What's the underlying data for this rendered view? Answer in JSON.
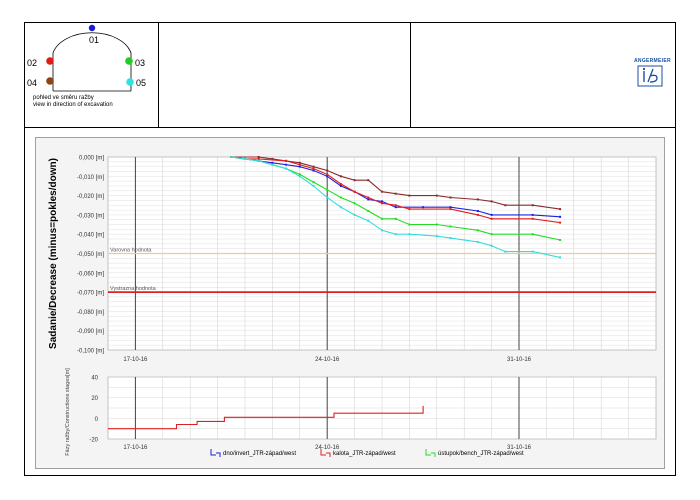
{
  "header": {
    "points": [
      {
        "id": "01",
        "color": "#1b1bd6"
      },
      {
        "id": "02",
        "color": "#e01b1b"
      },
      {
        "id": "03",
        "color": "#22cc22"
      },
      {
        "id": "04",
        "color": "#8b4513"
      },
      {
        "id": "05",
        "color": "#33e0e0"
      }
    ],
    "caption_line1": "pohled ve směru ražby",
    "caption_line2": "view in direction of excavation",
    "logo_text": "ANGERMEIER"
  },
  "chart_data": [
    {
      "type": "line",
      "ylabel": "Sadanie/Decrease (minus=pokles/down)",
      "xlim": [
        "2016-10-16",
        "2016-11-05"
      ],
      "ylim": [
        -0.1,
        0.0
      ],
      "y_ticks": [
        "0,000 [m]",
        "-0,010 [m]",
        "-0,020 [m]",
        "-0,030 [m]",
        "-0,040 [m]",
        "-0,050 [m]",
        "-0,060 [m]",
        "-0,070 [m]",
        "-0,080 [m]",
        "-0,090 [m]",
        "-0,100 [m]"
      ],
      "x_ticks": [
        {
          "label": "17-10-16",
          "x": "2016-10-17"
        },
        {
          "label": "24-10-16",
          "x": "2016-10-24"
        },
        {
          "label": "31-10-16",
          "x": "2016-10-31"
        }
      ],
      "thresholds": [
        {
          "label": "Varovna hodnota",
          "value": -0.05,
          "color": "#f0c890"
        },
        {
          "label": "Vystrazna hodnota",
          "value": -0.07,
          "color": "#e02020"
        }
      ],
      "series": [
        {
          "color": "#8b2a2a",
          "points": [
            [
              "2016-10-20 12:00",
              0.0
            ],
            [
              "2016-10-21 12:00",
              0.0
            ],
            [
              "2016-10-22 00:00",
              -0.001
            ],
            [
              "2016-10-22 12:00",
              -0.002
            ],
            [
              "2016-10-23 00:00",
              -0.003
            ],
            [
              "2016-10-23 12:00",
              -0.005
            ],
            [
              "2016-10-24 00:00",
              -0.007
            ],
            [
              "2016-10-24 12:00",
              -0.01
            ],
            [
              "2016-10-25 00:00",
              -0.012
            ],
            [
              "2016-10-25 12:00",
              -0.012
            ],
            [
              "2016-10-26 00:00",
              -0.018
            ],
            [
              "2016-10-26 12:00",
              -0.019
            ],
            [
              "2016-10-27 00:00",
              -0.02
            ],
            [
              "2016-10-28 00:00",
              -0.02
            ],
            [
              "2016-10-28 12:00",
              -0.021
            ],
            [
              "2016-10-29 12:00",
              -0.022
            ],
            [
              "2016-10-30 00:00",
              -0.023
            ],
            [
              "2016-10-30 12:00",
              -0.025
            ],
            [
              "2016-10-31 12:00",
              -0.025
            ],
            [
              "2016-11-01 12:00",
              -0.027
            ]
          ]
        },
        {
          "color": "#2020e0",
          "points": [
            [
              "2016-10-20 12:00",
              0.0
            ],
            [
              "2016-10-21 00:00",
              -0.001
            ],
            [
              "2016-10-21 12:00",
              -0.002
            ],
            [
              "2016-10-22 00:00",
              -0.003
            ],
            [
              "2016-10-22 12:00",
              -0.004
            ],
            [
              "2016-10-23 00:00",
              -0.005
            ],
            [
              "2016-10-23 12:00",
              -0.007
            ],
            [
              "2016-10-24 00:00",
              -0.01
            ],
            [
              "2016-10-24 12:00",
              -0.015
            ],
            [
              "2016-10-25 00:00",
              -0.018
            ],
            [
              "2016-10-25 12:00",
              -0.022
            ],
            [
              "2016-10-26 00:00",
              -0.023
            ],
            [
              "2016-10-26 12:00",
              -0.026
            ],
            [
              "2016-10-27 12:00",
              -0.026
            ],
            [
              "2016-10-28 12:00",
              -0.026
            ],
            [
              "2016-10-29 12:00",
              -0.028
            ],
            [
              "2016-10-30 00:00",
              -0.03
            ],
            [
              "2016-10-31 12:00",
              -0.03
            ],
            [
              "2016-11-01 12:00",
              -0.031
            ]
          ]
        },
        {
          "color": "#e02020",
          "points": [
            [
              "2016-10-20 12:00",
              0.0
            ],
            [
              "2016-10-21 00:00",
              -0.001
            ],
            [
              "2016-10-21 12:00",
              -0.001
            ],
            [
              "2016-10-22 12:00",
              -0.002
            ],
            [
              "2016-10-23 00:00",
              -0.004
            ],
            [
              "2016-10-23 12:00",
              -0.006
            ],
            [
              "2016-10-24 00:00",
              -0.009
            ],
            [
              "2016-10-24 12:00",
              -0.014
            ],
            [
              "2016-10-25 00:00",
              -0.018
            ],
            [
              "2016-10-25 12:00",
              -0.021
            ],
            [
              "2016-10-26 00:00",
              -0.024
            ],
            [
              "2016-10-26 12:00",
              -0.025
            ],
            [
              "2016-10-27 00:00",
              -0.027
            ],
            [
              "2016-10-28 12:00",
              -0.027
            ],
            [
              "2016-10-29 12:00",
              -0.03
            ],
            [
              "2016-10-30 00:00",
              -0.032
            ],
            [
              "2016-10-31 12:00",
              -0.032
            ],
            [
              "2016-11-01 12:00",
              -0.034
            ]
          ]
        },
        {
          "color": "#22dd22",
          "points": [
            [
              "2016-10-20 12:00",
              0.0
            ],
            [
              "2016-10-21 00:00",
              -0.001
            ],
            [
              "2016-10-21 12:00",
              -0.002
            ],
            [
              "2016-10-22 00:00",
              -0.004
            ],
            [
              "2016-10-22 12:00",
              -0.006
            ],
            [
              "2016-10-23 00:00",
              -0.009
            ],
            [
              "2016-10-23 12:00",
              -0.013
            ],
            [
              "2016-10-24 00:00",
              -0.017
            ],
            [
              "2016-10-24 12:00",
              -0.021
            ],
            [
              "2016-10-25 00:00",
              -0.024
            ],
            [
              "2016-10-25 12:00",
              -0.028
            ],
            [
              "2016-10-26 00:00",
              -0.032
            ],
            [
              "2016-10-26 12:00",
              -0.032
            ],
            [
              "2016-10-27 00:00",
              -0.035
            ],
            [
              "2016-10-28 00:00",
              -0.035
            ],
            [
              "2016-10-28 12:00",
              -0.036
            ],
            [
              "2016-10-29 12:00",
              -0.038
            ],
            [
              "2016-10-30 00:00",
              -0.04
            ],
            [
              "2016-10-31 12:00",
              -0.04
            ],
            [
              "2016-11-01 12:00",
              -0.043
            ]
          ]
        },
        {
          "color": "#33dddd",
          "points": [
            [
              "2016-10-20 12:00",
              0.0
            ],
            [
              "2016-10-21 00:00",
              -0.001
            ],
            [
              "2016-10-21 12:00",
              -0.002
            ],
            [
              "2016-10-22 00:00",
              -0.004
            ],
            [
              "2016-10-22 12:00",
              -0.006
            ],
            [
              "2016-10-23 00:00",
              -0.01
            ],
            [
              "2016-10-23 12:00",
              -0.015
            ],
            [
              "2016-10-24 00:00",
              -0.021
            ],
            [
              "2016-10-24 12:00",
              -0.026
            ],
            [
              "2016-10-25 00:00",
              -0.03
            ],
            [
              "2016-10-25 12:00",
              -0.033
            ],
            [
              "2016-10-26 00:00",
              -0.038
            ],
            [
              "2016-10-26 12:00",
              -0.04
            ],
            [
              "2016-10-27 00:00",
              -0.04
            ],
            [
              "2016-10-28 00:00",
              -0.041
            ],
            [
              "2016-10-28 12:00",
              -0.042
            ],
            [
              "2016-10-29 12:00",
              -0.044
            ],
            [
              "2016-10-30 00:00",
              -0.046
            ],
            [
              "2016-10-30 12:00",
              -0.049
            ],
            [
              "2016-10-31 12:00",
              -0.049
            ],
            [
              "2016-11-01 12:00",
              -0.052
            ]
          ]
        }
      ]
    },
    {
      "type": "line",
      "ylabel": "Fázy ražby/Constructions stages[m]",
      "xlim": [
        "2016-10-16",
        "2016-11-05"
      ],
      "ylim": [
        -20,
        40
      ],
      "y_ticks": [
        "40",
        "20",
        "0",
        "-20"
      ],
      "x_ticks": [
        {
          "label": "17-10-16",
          "x": "2016-10-17"
        },
        {
          "label": "24-10-16",
          "x": "2016-10-24"
        },
        {
          "label": "31-10-16",
          "x": "2016-10-31"
        }
      ],
      "series": [
        {
          "color": "#e02020",
          "step": true,
          "points": [
            [
              "2016-10-16",
              -10
            ],
            [
              "2016-10-18 12:00",
              -10
            ],
            [
              "2016-10-18 12:00",
              -6
            ],
            [
              "2016-10-19 06:00",
              -6
            ],
            [
              "2016-10-19 06:00",
              -3
            ],
            [
              "2016-10-20 06:00",
              -3
            ],
            [
              "2016-10-20 06:00",
              1
            ],
            [
              "2016-10-24 06:00",
              1
            ],
            [
              "2016-10-24 06:00",
              5
            ],
            [
              "2016-10-27 12:00",
              5
            ],
            [
              "2016-10-27 12:00",
              12
            ]
          ]
        }
      ]
    }
  ],
  "legend": [
    {
      "label": "dno/invert_JTR-západ/west",
      "color": "#2020e0"
    },
    {
      "label": "kalota_JTR-západ/west",
      "color": "#e02020"
    },
    {
      "label": "ústupok/bench_JTR-západ/west",
      "color": "#22dd22"
    }
  ]
}
